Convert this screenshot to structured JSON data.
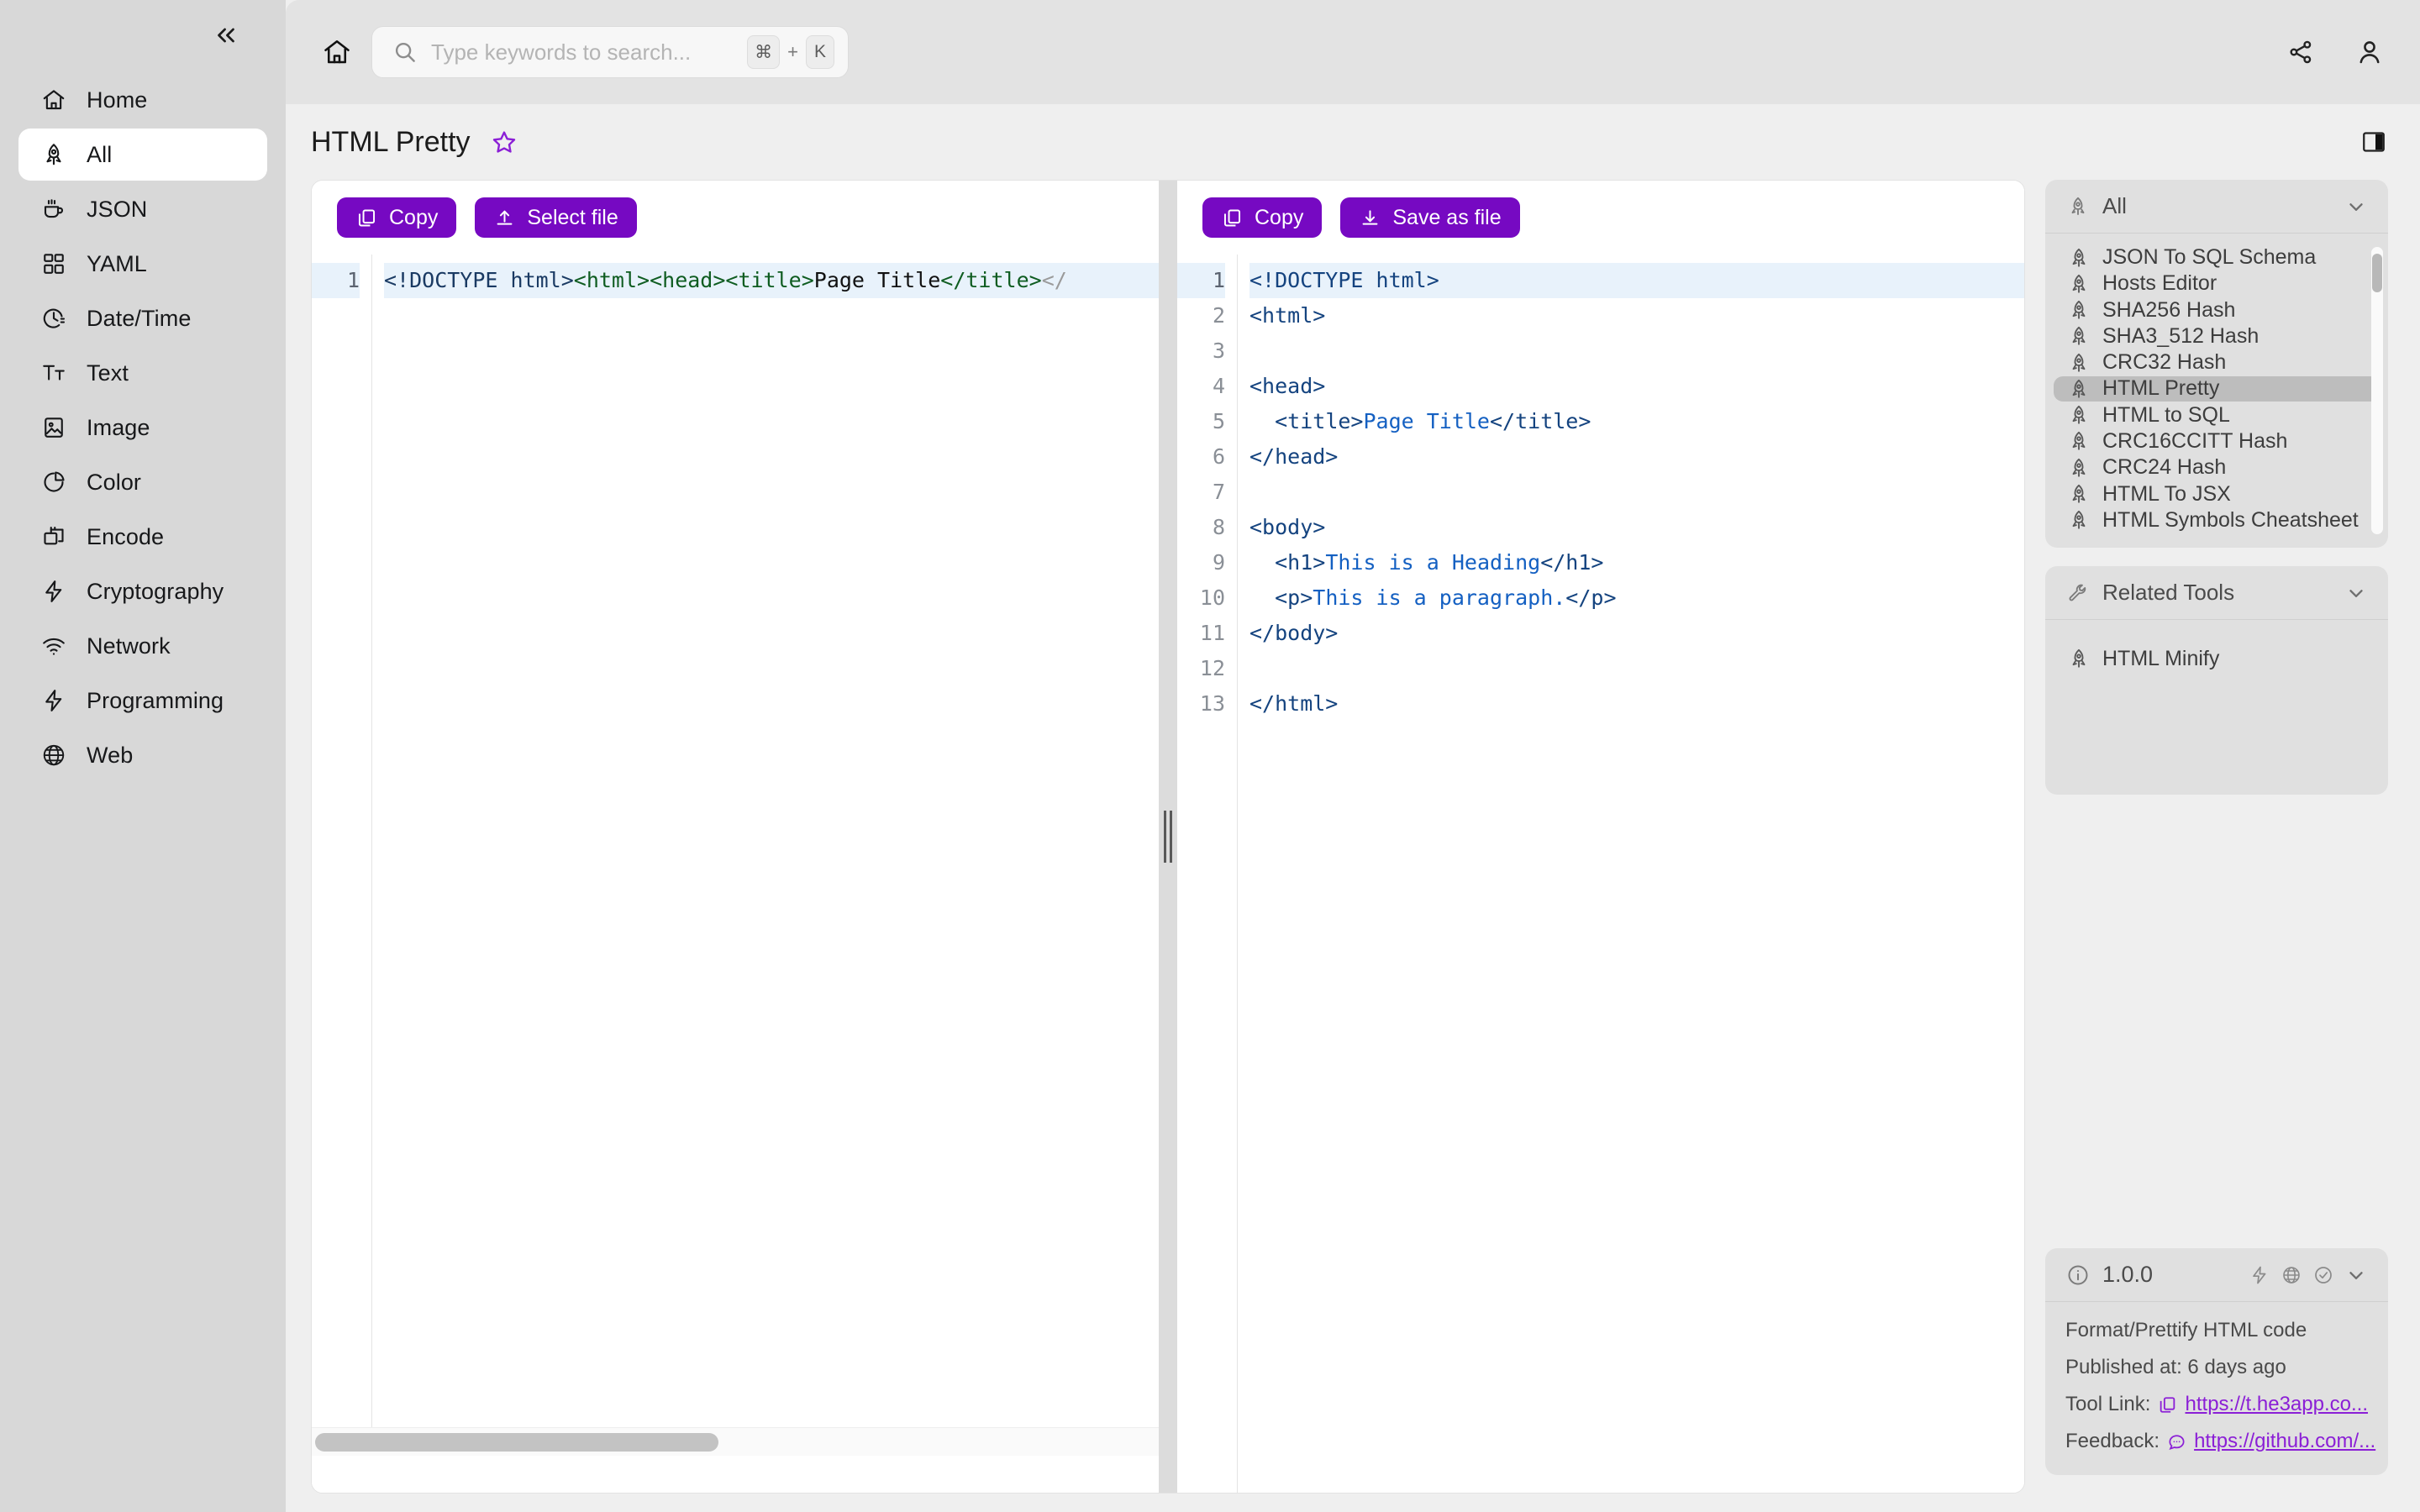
{
  "sidebar": {
    "collapse_label": "«",
    "items": [
      {
        "label": "Home",
        "icon": "home-icon",
        "active": false
      },
      {
        "label": "All",
        "icon": "rocket-icon",
        "active": true
      },
      {
        "label": "JSON",
        "icon": "coffee-icon",
        "active": false
      },
      {
        "label": "YAML",
        "icon": "grid-icon",
        "active": false
      },
      {
        "label": "Date/Time",
        "icon": "clock-icon",
        "active": false
      },
      {
        "label": "Text",
        "icon": "text-icon",
        "active": false
      },
      {
        "label": "Image",
        "icon": "image-icon",
        "active": false
      },
      {
        "label": "Color",
        "icon": "pie-chart-icon",
        "active": false
      },
      {
        "label": "Encode",
        "icon": "layers-icon",
        "active": false
      },
      {
        "label": "Cryptography",
        "icon": "bolt-icon",
        "active": false
      },
      {
        "label": "Network",
        "icon": "wifi-icon",
        "active": false
      },
      {
        "label": "Programming",
        "icon": "bolt-icon",
        "active": false
      },
      {
        "label": "Web",
        "icon": "globe-icon",
        "active": false
      }
    ]
  },
  "topbar": {
    "home_icon": "home-icon",
    "search": {
      "placeholder": "Type keywords to search...",
      "value": "",
      "icon": "search-icon",
      "kbd_mod": "⌘",
      "kbd_plus": "+",
      "kbd_key": "K"
    },
    "share_icon": "share-icon",
    "account_icon": "user-icon"
  },
  "title_bar": {
    "title": "HTML Pretty",
    "star_icon": "star-icon",
    "star_color": "#8b1fd6",
    "panel_toggle_icon": "panel-right-icon"
  },
  "editor_left": {
    "copy_label": "Copy",
    "copy_icon": "copy-icon",
    "select_file_label": "Select file",
    "select_file_icon": "upload-icon",
    "line_numbers": [
      "1"
    ],
    "raw_text": "<!DOCTYPE html><html><head><title>Page Title</title></",
    "tokens": [
      {
        "t": "<!DOCTYPE html>",
        "c": "tok-doctype"
      },
      {
        "t": "<html>",
        "c": "tok-tag"
      },
      {
        "t": "<head>",
        "c": "tok-tag"
      },
      {
        "t": "<title>",
        "c": "tok-tag"
      },
      {
        "t": "Page Title",
        "c": "tok-text"
      },
      {
        "t": "</title>",
        "c": "tok-tag"
      },
      {
        "t": "</",
        "c": "tok-punct"
      }
    ],
    "hscroll_visible": true
  },
  "editor_right": {
    "copy_label": "Copy",
    "copy_icon": "copy-icon",
    "save_label": "Save as file",
    "save_icon": "download-icon",
    "line_numbers": [
      "1",
      "2",
      "3",
      "4",
      "5",
      "6",
      "7",
      "8",
      "9",
      "10",
      "11",
      "12",
      "13"
    ],
    "lines": [
      "<!DOCTYPE html>",
      "<html>",
      "",
      "<head>",
      "  <title>Page Title</title>",
      "</head>",
      "",
      "<body>",
      "  <h1>This is a Heading</h1>",
      "  <p>This is a paragraph.</p>",
      "</body>",
      "",
      "</html>"
    ],
    "highlighted_line": 1
  },
  "right_sidebar": {
    "all_panel": {
      "title": "All",
      "icon": "rocket-icon",
      "chevron": "chevron-down-icon",
      "items": [
        {
          "label": "JSON To SQL Schema",
          "active": false
        },
        {
          "label": "Hosts Editor",
          "active": false
        },
        {
          "label": "SHA256 Hash",
          "active": false
        },
        {
          "label": "SHA3_512 Hash",
          "active": false
        },
        {
          "label": "CRC32 Hash",
          "active": false
        },
        {
          "label": "HTML Pretty",
          "active": true
        },
        {
          "label": "HTML to SQL",
          "active": false
        },
        {
          "label": "CRC16CCITT Hash",
          "active": false
        },
        {
          "label": "CRC24 Hash",
          "active": false
        },
        {
          "label": "HTML To JSX",
          "active": false
        },
        {
          "label": "HTML Symbols Cheatsheet",
          "active": false
        }
      ]
    },
    "related_panel": {
      "title": "Related Tools",
      "icon": "wrench-icon",
      "chevron": "chevron-down-icon",
      "items": [
        {
          "label": "HTML Minify",
          "active": false
        }
      ]
    },
    "info_panel": {
      "version": "1.0.0",
      "info_icon": "info-circle-icon",
      "badges": [
        "bolt-icon",
        "globe-icon",
        "check-circle-icon"
      ],
      "chevron": "chevron-down-icon",
      "description": "Format/Prettify HTML code",
      "published_label": "Published at: 6 days ago",
      "tool_link_label": "Tool Link:",
      "tool_link_icon": "copy-icon",
      "tool_link_url": "https://t.he3app.co...",
      "feedback_label": "Feedback:",
      "feedback_icon": "chat-icon",
      "feedback_url": "https://github.com/..."
    }
  },
  "colors": {
    "accent": "#7609c2",
    "accent_light": "#8b1fd6",
    "sidebar_bg": "#d8d8d8",
    "page_bg": "#efefef",
    "card_bg": "#e0e0e0",
    "code_highlight": "#e8f2fb"
  }
}
